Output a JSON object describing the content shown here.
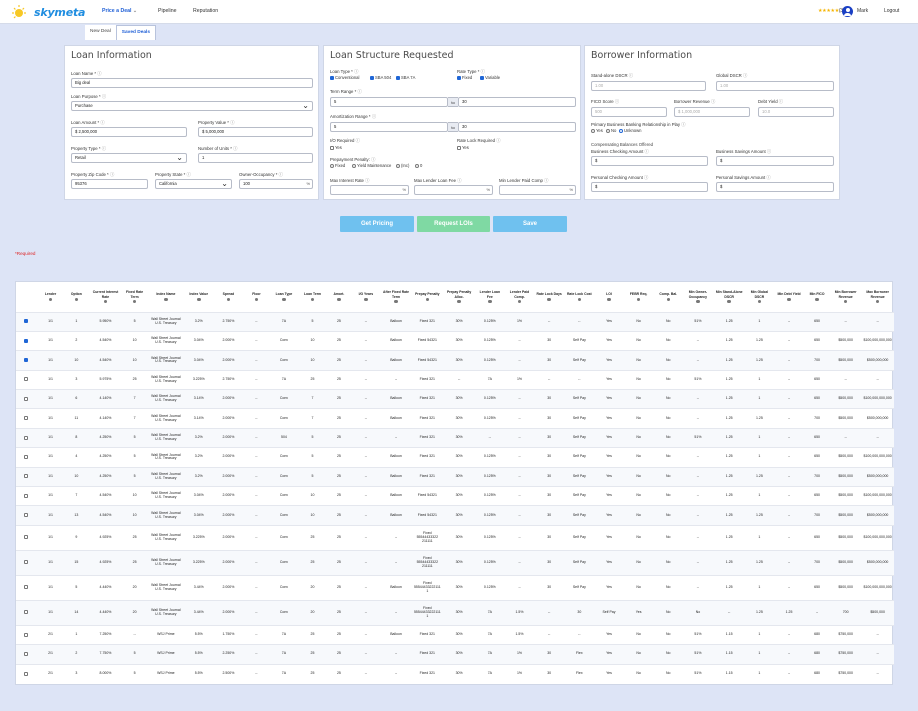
{
  "nav": {
    "brand": "skymeta",
    "items": [
      {
        "label": "Price a Deal",
        "active": true,
        "has_dropdown": true
      },
      {
        "label": "Pipeline",
        "active": false
      },
      {
        "label": "Reputation",
        "active": false
      }
    ],
    "rating": {
      "stars": "★★★★★",
      "count": "(39)"
    },
    "user_name": "Mark",
    "logout": "Logout"
  },
  "tabs": [
    {
      "label": "New Deal",
      "active": false
    },
    {
      "label": "Saved Deals",
      "active": true
    }
  ],
  "loan_info": {
    "title": "Loan Information",
    "loan_name_label": "Loan Name *",
    "loan_name": "Big deal",
    "loan_purpose_label": "Loan Purpose *",
    "loan_purpose": "Purchase",
    "loan_amount_label": "Loan Amount *",
    "loan_amount": "$ 2,500,000",
    "property_value_label": "Property Value *",
    "property_value": "$ 5,000,000",
    "property_type_label": "Property Type *",
    "property_type": "Retail",
    "num_units_label": "Number of Units *",
    "num_units": "1",
    "zip_label": "Property Zip Code *",
    "zip": "95376",
    "state_label": "Property State *",
    "state": "California",
    "owner_occ_label": "Owner-Occupancy *",
    "owner_occ": "100",
    "owner_occ_suffix": "%"
  },
  "loan_structure": {
    "title": "Loan Structure Requested",
    "loan_type_label": "Loan Type *",
    "loan_types": [
      {
        "label": "Conventional",
        "checked": true
      },
      {
        "label": "SBA 504",
        "checked": true
      },
      {
        "label": "SBA 7A",
        "checked": true
      }
    ],
    "rate_type_label": "Rate Type *",
    "rate_types": [
      {
        "label": "Fixed",
        "checked": true
      },
      {
        "label": "Variable",
        "checked": true
      }
    ],
    "term_range_label": "Term Range *",
    "term_from": "5",
    "term_to": "30",
    "to_word": "to",
    "amort_range_label": "Amortization Range *",
    "amort_from": "5",
    "amort_to": "30",
    "io_label": "I/O Required",
    "io_yes": "Yes",
    "rate_lock_label": "Rate Lock Required",
    "rate_lock_yes": "Yes",
    "prepay_label": "Prepayment Penalty:",
    "prepay_opts": [
      "Fixed",
      "Yield Maintenance",
      "(Inc)",
      "0"
    ],
    "max_rate_label": "Max Interest Rate",
    "max_lender_fee_label": "Max Lender Loan Fee",
    "min_lender_paid_label": "Min Lender Paid Comp",
    "pct": "%"
  },
  "borrower": {
    "title": "Borrower Information",
    "standalone_dscr_label": "Stand-alone DSCR",
    "standalone_dscr_ph": "1.00",
    "global_dscr_label": "Global DSCR",
    "global_dscr_ph": "1.00",
    "fico_label": "FICO Score",
    "fico_ph": "500",
    "revenue_label": "Borrower Revenue",
    "revenue_ph": "$ 1,000,000",
    "debt_yield_label": "Debt Yield",
    "debt_yield_ph": "10.0",
    "primary_banking_label": "Primary Business Banking Relationship in Play",
    "primary_opts": [
      {
        "label": "Yes",
        "on": false
      },
      {
        "label": "No",
        "on": false
      },
      {
        "label": "Unknown",
        "on": true
      }
    ],
    "comp_bal_label": "Compensating Balances Offered",
    "biz_checking_label": "Business Checking Amount",
    "biz_checking": "$",
    "biz_savings_label": "Business Savings Amount",
    "biz_savings": "$",
    "pers_checking_label": "Personal Checking Amount",
    "pers_checking": "$",
    "pers_savings_label": "Personal Savings Amount",
    "pers_savings": "$"
  },
  "buttons": {
    "get_pricing": "Get Pricing",
    "request_lois": "Request LOIs",
    "save": "Save"
  },
  "required_note": "*Required",
  "colors": {
    "brand": "#1f8de0",
    "btn_blue": "#6fc1ef",
    "btn_green": "#7fd9a3",
    "accent": "#1f5fd6"
  },
  "table": {
    "headers": [
      "",
      "Lender",
      "Option",
      "Current Interest Rate",
      "Fixed Rate Term",
      "Index Name",
      "Index Value",
      "Spread",
      "Floor",
      "Loan Type",
      "Loan Term",
      "Amort.",
      "I/O Years",
      "After Fixed Rate Term",
      "Prepay Penalty",
      "Prepay Penalty Alloc.",
      "Lender Loan Fee",
      "Lender Paid Comp.",
      "Rate Lock Days",
      "Rate Lock Cost",
      "LOI",
      "FEBR Req.",
      "Comp. Bal.",
      "Min Owner-Occupancy",
      "Min Stand-Alone DSCR",
      "Min Global DSCR",
      "Min Debt Yield",
      "Min FICO",
      "Min Borrower Revenue",
      "Max Borrower Revenue"
    ],
    "header_info": [
      false,
      true,
      true,
      true,
      true,
      true,
      true,
      true,
      true,
      true,
      true,
      true,
      true,
      true,
      true,
      true,
      true,
      true,
      true,
      true,
      true,
      true,
      true,
      true,
      true,
      true,
      true,
      true,
      true,
      true
    ],
    "rows": [
      {
        "checked": true,
        "cells": [
          "1/1",
          "1",
          "5.950%",
          "5",
          "Wall Street Journal U.S. Treasury",
          "3.2%",
          "2.750%",
          "--",
          "7A",
          "5",
          "25",
          "--",
          "Balloon",
          "Fixed 321",
          "30%",
          "0.125%",
          "1%",
          "--",
          "--",
          "Yes",
          "No",
          "No",
          "51%",
          "1.25",
          "1",
          "--",
          "650",
          "--",
          "--"
        ]
      },
      {
        "checked": true,
        "cells": [
          "1/1",
          "2",
          "4.540%",
          "10",
          "Wall Street Journal U.S. Treasury",
          "3.04%",
          "2.000%",
          "--",
          "Conv",
          "10",
          "25",
          "--",
          "Balloon",
          "Fixed 54321",
          "30%",
          "0.125%",
          "--",
          "30",
          "Self Pay",
          "Yes",
          "No",
          "No",
          "--",
          "1.25",
          "1.25",
          "--",
          "650",
          "$500,000",
          "$100,000,000,000"
        ]
      },
      {
        "checked": true,
        "cells": [
          "1/1",
          "10",
          "4.540%",
          "10",
          "Wall Street Journal U.S. Treasury",
          "3.04%",
          "2.000%",
          "--",
          "Conv",
          "10",
          "25",
          "--",
          "Balloon",
          "Fixed 54321",
          "30%",
          "0.125%",
          "--",
          "30",
          "Self Pay",
          "Yes",
          "No",
          "No",
          "--",
          "1.25",
          "1.25",
          "--",
          "700",
          "$500,000",
          "$500,000,000"
        ]
      },
      {
        "checked": false,
        "cells": [
          "1/1",
          "3",
          "5.975%",
          "25",
          "Wall Street Journal U.S. Treasury",
          "3.225%",
          "2.750%",
          "--",
          "7A",
          "25",
          "25",
          "--",
          "--",
          "Fixed 321",
          "--",
          "7A",
          "1%",
          "--",
          "--",
          "Yes",
          "No",
          "No",
          "51%",
          "1.25",
          "1",
          "--",
          "650",
          "--",
          "--"
        ]
      },
      {
        "checked": false,
        "cells": [
          "1/1",
          "6",
          "4.140%",
          "7",
          "Wall Street Journal U.S. Treasury",
          "3.14%",
          "2.000%",
          "--",
          "Conv",
          "7",
          "25",
          "--",
          "Balloon",
          "Fixed 321",
          "30%",
          "0.125%",
          "--",
          "30",
          "Self Pay",
          "Yes",
          "No",
          "No",
          "--",
          "1.25",
          "1",
          "--",
          "650",
          "$500,000",
          "$100,000,000,000"
        ]
      },
      {
        "checked": false,
        "cells": [
          "1/1",
          "11",
          "4.140%",
          "7",
          "Wall Street Journal U.S. Treasury",
          "3.14%",
          "2.000%",
          "--",
          "Conv",
          "7",
          "25",
          "--",
          "Balloon",
          "Fixed 321",
          "30%",
          "0.125%",
          "--",
          "30",
          "Self Pay",
          "Yes",
          "No",
          "No",
          "--",
          "1.25",
          "1.25",
          "--",
          "700",
          "$500,000",
          "$500,000,000"
        ]
      },
      {
        "checked": false,
        "cells": [
          "1/1",
          "8",
          "4.250%",
          "5",
          "Wall Street Journal U.S. Treasury",
          "3.2%",
          "2.000%",
          "--",
          "504",
          "5",
          "25",
          "--",
          "--",
          "Fixed 321",
          "30%",
          "--",
          "--",
          "30",
          "Self Pay",
          "Yes",
          "No",
          "No",
          "51%",
          "1.25",
          "1",
          "--",
          "650",
          "--",
          "--"
        ]
      },
      {
        "checked": false,
        "cells": [
          "1/1",
          "4",
          "4.250%",
          "5",
          "Wall Street Journal U.S. Treasury",
          "3.2%",
          "2.000%",
          "--",
          "Conv",
          "5",
          "25",
          "--",
          "Balloon",
          "Fixed 321",
          "30%",
          "0.125%",
          "--",
          "30",
          "Self Pay",
          "Yes",
          "No",
          "No",
          "--",
          "1.25",
          "1",
          "--",
          "650",
          "$500,000",
          "$100,000,000,000"
        ]
      },
      {
        "checked": false,
        "cells": [
          "1/1",
          "10",
          "4.250%",
          "5",
          "Wall Street Journal U.S. Treasury",
          "3.2%",
          "2.000%",
          "--",
          "Conv",
          "5",
          "25",
          "--",
          "Balloon",
          "Fixed 321",
          "30%",
          "0.125%",
          "--",
          "30",
          "Self Pay",
          "Yes",
          "No",
          "No",
          "--",
          "1.25",
          "1.25",
          "--",
          "700",
          "$500,000",
          "$500,000,000"
        ]
      },
      {
        "checked": false,
        "cells": [
          "1/1",
          "7",
          "4.540%",
          "10",
          "Wall Street Journal U.S. Treasury",
          "3.04%",
          "2.000%",
          "--",
          "Conv",
          "10",
          "25",
          "--",
          "Balloon",
          "Fixed 54321",
          "30%",
          "0.125%",
          "--",
          "30",
          "Self Pay",
          "Yes",
          "No",
          "No",
          "--",
          "1.25",
          "1",
          "--",
          "650",
          "$500,000",
          "$100,000,000,000"
        ]
      },
      {
        "checked": false,
        "cells": [
          "1/1",
          "13",
          "4.540%",
          "10",
          "Wall Street Journal U.S. Treasury",
          "3.04%",
          "2.000%",
          "--",
          "Conv",
          "10",
          "25",
          "--",
          "Balloon",
          "Fixed 54321",
          "30%",
          "0.125%",
          "--",
          "30",
          "Self Pay",
          "Yes",
          "No",
          "No",
          "--",
          "1.25",
          "1.25",
          "--",
          "700",
          "$500,000",
          "$500,000,000"
        ]
      },
      {
        "checked": false,
        "cells": [
          "1/1",
          "9",
          "4.925%",
          "25",
          "Wall Street Journal U.S. Treasury",
          "3.225%",
          "2.000%",
          "--",
          "Conv",
          "25",
          "25",
          "--",
          "--",
          "Fixed 55544433322 211111",
          "30%",
          "0.125%",
          "--",
          "30",
          "Self Pay",
          "Yes",
          "No",
          "No",
          "--",
          "1.25",
          "1",
          "--",
          "650",
          "$500,000",
          "$100,000,000,000"
        ]
      },
      {
        "checked": false,
        "cells": [
          "1/1",
          "15",
          "4.925%",
          "25",
          "Wall Street Journal U.S. Treasury",
          "3.225%",
          "2.000%",
          "--",
          "Conv",
          "25",
          "25",
          "--",
          "--",
          "Fixed 55544433322 211111",
          "30%",
          "0.125%",
          "--",
          "30",
          "Self Pay",
          "Yes",
          "No",
          "No",
          "--",
          "1.25",
          "1.25",
          "--",
          "700",
          "$500,000",
          "$500,000,000"
        ]
      },
      {
        "checked": false,
        "cells": [
          "1/1",
          "5",
          "4.440%",
          "20",
          "Wall Street Journal U.S. Treasury",
          "3.44%",
          "2.000%",
          "--",
          "Conv",
          "20",
          "25",
          "--",
          "Balloon",
          "Fixed 55544433222111 1",
          "30%",
          "0.125%",
          "--",
          "30",
          "Self Pay",
          "Yes",
          "No",
          "No",
          "--",
          "1.25",
          "1",
          "--",
          "650",
          "$500,000",
          "$100,000,000,000"
        ]
      },
      {
        "checked": false,
        "cells": [
          "1/1",
          "14",
          "4.440%",
          "20",
          "Wall Street Journal U.S. Treasury",
          "3.44%",
          "2.000%",
          "--",
          "Conv",
          "20",
          "25",
          "--",
          "--",
          "Fixed 55544433222111 1",
          "30%",
          "7A",
          "1.5%",
          "--",
          "30",
          "Self Pay",
          "Yes",
          "No",
          "No",
          "--",
          "1.25",
          "1.25",
          "--",
          "700",
          "$500,000"
        ]
      },
      {
        "checked": false,
        "cells": [
          "2/1",
          "1",
          "7.250%",
          "--",
          "WSJ Prime",
          "5.5%",
          "1.750%",
          "--",
          "7A",
          "25",
          "25",
          "--",
          "Balloon",
          "Fixed 321",
          "30%",
          "7A",
          "1.5%",
          "--",
          "--",
          "Yes",
          "No",
          "No",
          "51%",
          "1.15",
          "1",
          "--",
          "680",
          "$750,000",
          "--"
        ]
      },
      {
        "checked": false,
        "cells": [
          "2/1",
          "2",
          "7.750%",
          "5",
          "WSJ Prime",
          "5.5%",
          "2.250%",
          "--",
          "7A",
          "25",
          "25",
          "--",
          "--",
          "Fixed 321",
          "30%",
          "7A",
          "1%",
          "30",
          "Flex",
          "Yes",
          "No",
          "No",
          "51%",
          "1.15",
          "1",
          "--",
          "680",
          "$750,000",
          "--"
        ]
      },
      {
        "checked": false,
        "cells": [
          "2/1",
          "3",
          "8.000%",
          "5",
          "WSJ Prime",
          "5.5%",
          "2.500%",
          "--",
          "7A",
          "25",
          "25",
          "--",
          "--",
          "Fixed 321",
          "30%",
          "7A",
          "1%",
          "30",
          "Flex",
          "Yes",
          "No",
          "No",
          "51%",
          "1.15",
          "1",
          "--",
          "680",
          "$750,000",
          "--"
        ]
      }
    ]
  }
}
